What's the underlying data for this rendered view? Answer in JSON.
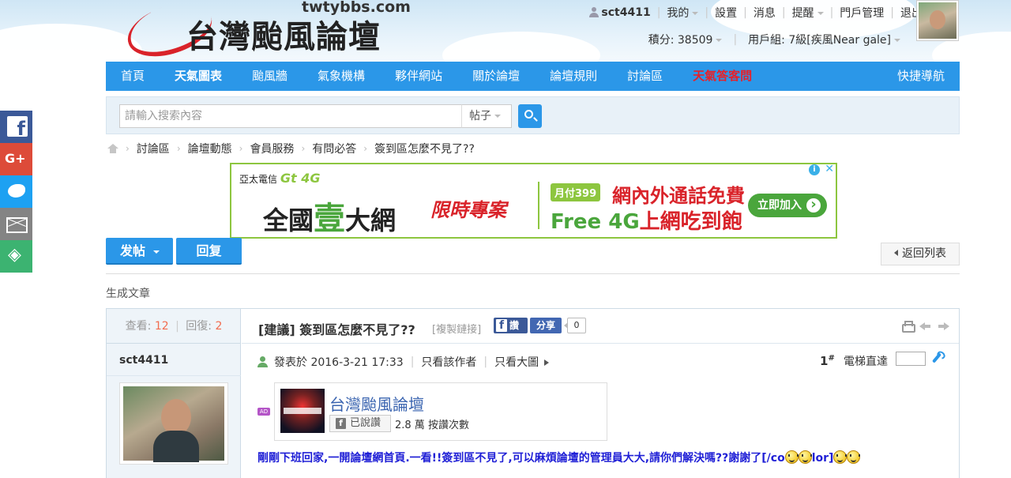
{
  "header": {
    "logo_url": "twtybbs.com",
    "logo_title": "台灣颱風論壇",
    "username": "sct4411",
    "user_menu": [
      "我的",
      "設置",
      "消息",
      "提醒",
      "門戶管理",
      "退出"
    ],
    "credits_label": "積分: 38509",
    "usergroup_label": "用戶組: 7級[疾風Near gale]"
  },
  "mainnav": {
    "items": [
      "首頁",
      "天氣圖表",
      "颱風牆",
      "氣象機構",
      "夥伴網站",
      "關於論壇",
      "論壇規則",
      "討論區",
      "天氣答客問"
    ],
    "quick": "快捷導航"
  },
  "search": {
    "placeholder": "請輸入搜索內容",
    "type": "帖子"
  },
  "breadcrumb": [
    "討論區",
    "論壇動態",
    "會員服務",
    "有問必答",
    "簽到區怎麼不見了??"
  ],
  "ad": {
    "brand": "亞太電信",
    "brand_logo": "Gt 4G",
    "headline_a": "全國",
    "headline_b": "壹",
    "headline_c": "大網",
    "script": "限時專案",
    "price": "月付399",
    "line1": "網內外通話免費",
    "line2_a": "Free 4G",
    "line2_b": "上網吃到飽",
    "cta": "立即加入"
  },
  "actions": {
    "post": "发帖",
    "reply": "回复",
    "back": "返回列表"
  },
  "generate_article": "生成文章",
  "thread": {
    "views_label": "查看:",
    "views": "12",
    "replies_label": "回復:",
    "replies": "2",
    "title": "[建議] 簽到區怎麼不見了??",
    "copy_link": "[複製鏈接]",
    "fb_like": "讚",
    "fb_share": "分享",
    "share_count": "0",
    "author": "sct4411",
    "posted_at": "發表於 2016-3-21 17:33",
    "only_author": "只看該作者",
    "only_large": "只看大圖",
    "floor": "1",
    "floor_mark": "#",
    "elevator": "電梯直達",
    "ad_badge": "AD",
    "fb_page_name": "台灣颱風論壇",
    "fb_liked": "已說讚",
    "fb_like_count": "2.8 萬 按讚次數",
    "body": "剛剛下班回家,一開論壇網首頁.一看!!簽到區不見了,可以麻煩論壇的管理員大大,請你們解決嗎??謝謝了[/co",
    "body_tail": "lor]"
  },
  "social": [
    "facebook-icon",
    "google-plus-icon",
    "twitter-icon",
    "email-icon",
    "share-icon"
  ],
  "colors": {
    "nav_blue": "#2b97e8",
    "highlight_red": "#e6212a",
    "post_text_blue": "#1f1fd6"
  }
}
